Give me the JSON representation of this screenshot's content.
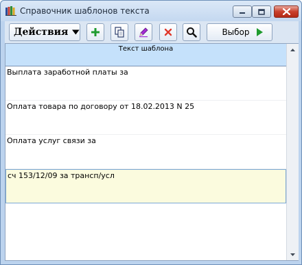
{
  "window": {
    "title": "Справочник шаблонов текста",
    "icons": {
      "app": "books-icon",
      "minimize": "minimize-icon",
      "maximize": "maximize-icon",
      "close": "close-icon"
    }
  },
  "toolbar": {
    "actions_label": "Действия",
    "select_label": "Выбор",
    "icons": [
      "plus-icon",
      "copy-icon",
      "pencil-icon",
      "x-icon",
      "magnifier-icon",
      "play-arrow-icon"
    ]
  },
  "grid": {
    "column_header": "Текст шаблона",
    "rows": [
      "Выплата заработной платы за",
      "Оплата товара по договору от 18.02.2013 N 25",
      "Оплата услуг связи за",
      "сч 153/12/09 за трансп/усл"
    ],
    "selected_row": 3
  },
  "colors": {
    "header_bg": "#c5e1fb",
    "selected_row_bg": "#fbfbde",
    "add_green": "#1f9b2e",
    "delete_red": "#e0382b",
    "edit_purple": "#a42cd3"
  }
}
